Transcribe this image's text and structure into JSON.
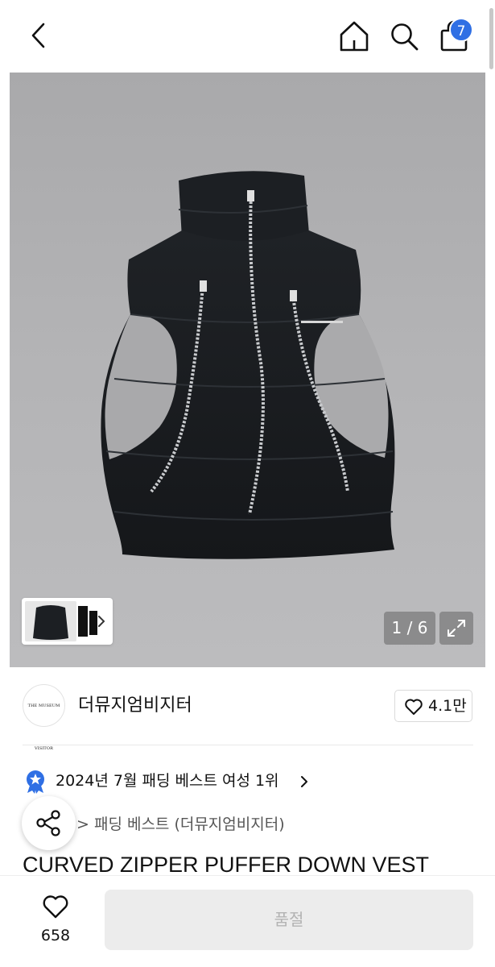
{
  "header": {
    "back_icon": "chevron-left-icon",
    "home_icon": "home-icon",
    "search_icon": "search-icon",
    "cart_icon": "shopping-bag-icon",
    "cart_count": "7",
    "badge_color": "#2f6fe4"
  },
  "gallery": {
    "counter": "1 / 6",
    "current": 1,
    "total": 6,
    "expand_icon": "expand-icon",
    "thumb_next_icon": "chevron-right-icon"
  },
  "brand": {
    "logo_text": "THE MUSEUM VISITOR",
    "name": "더뮤지엄비지터",
    "likes": "4.1만"
  },
  "product": {
    "ranking_text": "2024년 7월 패딩 베스트 여성 1위",
    "ranking_icon": "star-badge-icon",
    "breadcrumb": "> 패딩 베스트 (더뮤지엄비지터)",
    "title": "CURVED ZIPPER PUFFER DOWN VEST"
  },
  "bottom": {
    "like_count": "658",
    "soldout_label": "품절"
  }
}
